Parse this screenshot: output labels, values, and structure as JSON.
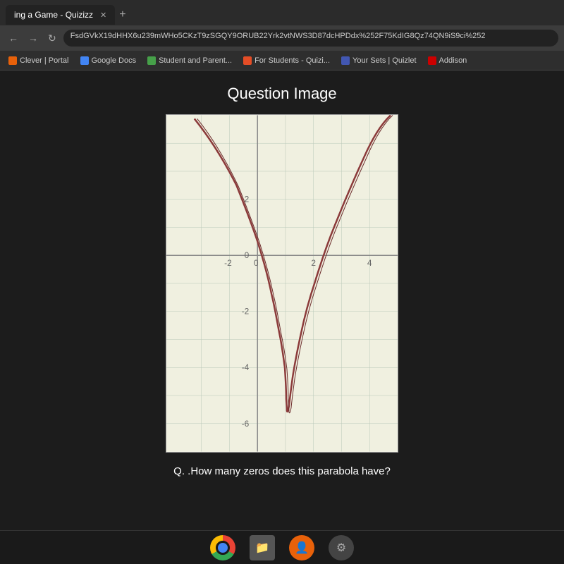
{
  "browser": {
    "tab_label": "ing a Game - Quizizz",
    "tab_plus": "+",
    "address": "FsdGVkX19dHHX6u239mWHo5CKzT9zSGQY9ORUB22Yrk2vtNWS3D87dcHPDdx%252F75KdIG8Qz74QN9iS9ci%252",
    "bookmarks": [
      {
        "label": "Clever | Portal",
        "color": "#e8610a"
      },
      {
        "label": "Google Docs",
        "color": "#4285f4"
      },
      {
        "label": "Student and Parent...",
        "color": "#46a049"
      },
      {
        "label": "For Students - Quizi...",
        "color": "#e44d26"
      },
      {
        "label": "Your Sets | Quizlet",
        "color": "#4257b2"
      },
      {
        "label": "Addison",
        "color": "#cc0000"
      }
    ]
  },
  "main": {
    "title": "Question Image",
    "question": "Q. .How many zeros does this parabola have?"
  },
  "graph": {
    "x_labels": [
      "-2",
      "0",
      "2",
      "4"
    ],
    "y_labels": [
      "2",
      "0",
      "-2",
      "-4",
      "-6"
    ],
    "axis_color": "#888888",
    "grid_color": "#c8d8c8",
    "curve_color": "#8b3a3a"
  },
  "taskbar": {
    "icons": [
      "chrome",
      "files",
      "orange",
      "gray"
    ]
  }
}
